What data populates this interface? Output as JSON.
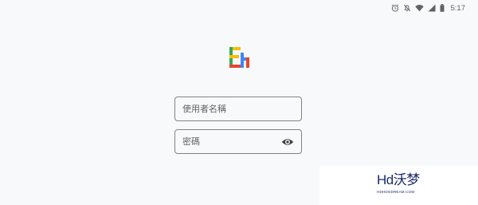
{
  "status_bar": {
    "time": "5:17",
    "icons": [
      "alarm-icon",
      "vibrate-off-icon",
      "wifi-icon",
      "signal-icon",
      "battery-icon"
    ]
  },
  "logo": {
    "icon": "app-logo-icon",
    "colors": [
      "#fbbc04",
      "#34a853",
      "#4285f4",
      "#ea4335"
    ]
  },
  "login": {
    "username_placeholder": "使用者名稱",
    "password_placeholder": "密碼",
    "show_password_icon": "eye-icon"
  },
  "watermark": {
    "text": "Hd沃梦",
    "subtext": "HDHDODREAM.COM"
  }
}
